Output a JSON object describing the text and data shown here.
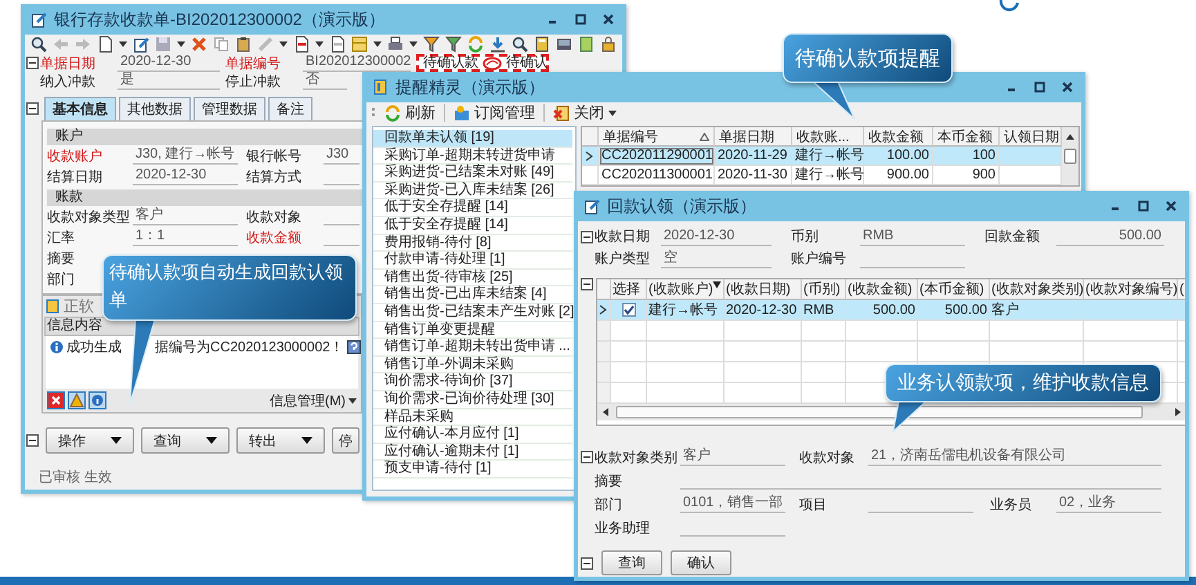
{
  "bank_receipt_window": {
    "title": "银行存款收款单-BI202012300002（演示版）",
    "flagged_tabs": [
      "待确认款",
      "待确认"
    ],
    "header_fields": [
      {
        "label": "单据日期",
        "value": "2020-12-30",
        "required": true
      },
      {
        "label": "单据编号",
        "value": "BI202012300002",
        "required": true
      },
      {
        "label": "纳入冲款",
        "value": "是",
        "required": false
      },
      {
        "label": "停止冲款",
        "value": "否",
        "required": false
      }
    ],
    "tabs": [
      {
        "label": "基本信息",
        "selected": true
      },
      {
        "label": "其他数据",
        "selected": false
      },
      {
        "label": "管理数据",
        "selected": false
      },
      {
        "label": "备注",
        "selected": false
      }
    ],
    "sections": [
      {
        "title": "账户",
        "rows": [
          [
            {
              "label": "收款账户",
              "value": "J30, 建行→帐号",
              "required": true
            },
            {
              "label": "银行帐号",
              "value": "J30",
              "required": false
            }
          ],
          [
            {
              "label": "结算日期",
              "value": "2020-12-30",
              "required": false
            },
            {
              "label": "结算方式",
              "required": false
            }
          ]
        ]
      },
      {
        "title": "账款",
        "rows": [
          [
            {
              "label": "收款对象类型",
              "value": "客户",
              "required": false
            },
            {
              "label": "收款对象",
              "required": false
            }
          ],
          [
            {
              "label": "汇率",
              "value": "1：1",
              "required": false
            },
            {
              "label": "收款金额",
              "required": true
            }
          ],
          [
            {
              "label": "摘要",
              "required": false
            }
          ],
          [
            {
              "label": "部门",
              "required": false
            }
          ]
        ]
      }
    ],
    "message_panel": {
      "title": "正软",
      "column": "信息内容",
      "message_parts": [
        "成功生成",
        "据编号为CC2020123000002！"
      ],
      "menu": "信息管理(M)"
    },
    "buttons": [
      {
        "label": "操作",
        "dropdown": true
      },
      {
        "label": "查询",
        "dropdown": true
      },
      {
        "label": "转出",
        "dropdown": true
      },
      {
        "label": "停",
        "dropdown": false
      }
    ],
    "status": "已审核 生效"
  },
  "reminder_window": {
    "title": "提醒精灵（演示版）",
    "toolbar": [
      {
        "label": "刷新",
        "kind": "refresh",
        "dropdown": false
      },
      {
        "label": "订阅管理",
        "kind": "subscribe",
        "dropdown": false
      },
      {
        "label": "关闭",
        "kind": "close",
        "dropdown": true
      }
    ],
    "items": [
      {
        "label": "回款单未认领 [19]",
        "selected": true
      },
      {
        "label": "采购订单-超期未转进货申请",
        "selected": false
      },
      {
        "label": "采购进货-已结案未对账 [49]",
        "selected": false
      },
      {
        "label": "采购进货-已入库未结案 [26]",
        "selected": false
      },
      {
        "label": "低于安全存提醒 [14]",
        "selected": false
      },
      {
        "label": "低于安全存提醒 [14]",
        "selected": false
      },
      {
        "label": "费用报销-待付 [8]",
        "selected": false
      },
      {
        "label": "付款申请-待处理 [1]",
        "selected": false
      },
      {
        "label": "销售出货-待审核 [25]",
        "selected": false
      },
      {
        "label": "销售出货-已出库未结案 [4]",
        "selected": false
      },
      {
        "label": "销售出货-已结案未产生对账 [2]",
        "selected": false
      },
      {
        "label": "销售订单变更提醒",
        "selected": false
      },
      {
        "label": "销售订单-超期未转出货申请 ...",
        "selected": false
      },
      {
        "label": "销售订单-外调未采购",
        "selected": false
      },
      {
        "label": "询价需求-待询价 [37]",
        "selected": false
      },
      {
        "label": "询价需求-已询价待处理 [30]",
        "selected": false
      },
      {
        "label": "样品未采购",
        "selected": false
      },
      {
        "label": "应付确认-本月应付 [1]",
        "selected": false
      },
      {
        "label": "应付确认-逾期未付 [1]",
        "selected": false
      },
      {
        "label": "预支申请-待付 [1]",
        "selected": false
      }
    ],
    "table": {
      "columns": [
        {
          "label": "单据编号",
          "kind": "text",
          "sorted": true
        },
        {
          "label": "单据日期",
          "kind": "text",
          "sorted": false
        },
        {
          "label": "收款账...",
          "kind": "text",
          "sorted": false
        },
        {
          "label": "收款金额",
          "kind": "amount",
          "sorted": false
        },
        {
          "label": "本币金额",
          "kind": "amount",
          "sorted": false
        },
        {
          "label": "认领日期",
          "kind": "text",
          "sorted": false
        }
      ],
      "rows": [
        {
          "selected": true,
          "cells": [
            "CC202011290001",
            "2020-11-29",
            "建行→帐号",
            "100.00",
            "100"
          ]
        },
        {
          "selected": false,
          "cells": [
            "CC202011300001",
            "2020-11-30",
            "建行→帐号",
            "900.00",
            "900"
          ]
        }
      ]
    }
  },
  "claim_window": {
    "title": "回款认领（演示版）",
    "header_fields": [
      {
        "label": "收款日期",
        "value": "2020-12-30",
        "kind": "text"
      },
      {
        "label": "币别",
        "value": "RMB",
        "kind": "text"
      },
      {
        "label": "回款金额",
        "value": "500.00",
        "kind": "amount"
      },
      {
        "label": "账户类型",
        "value": "空",
        "kind": "text"
      },
      {
        "label": "账户编号",
        "kind": "text"
      }
    ],
    "grid": {
      "columns": [
        {
          "label": "选择",
          "kind": "check",
          "sorted": false
        },
        {
          "label": "(收款账户)",
          "kind": "text",
          "sorted": true
        },
        {
          "label": "(收款日期)",
          "kind": "text",
          "sorted": false
        },
        {
          "label": "(币别)",
          "kind": "text",
          "sorted": false
        },
        {
          "label": "(收款金额)",
          "kind": "amount",
          "sorted": false
        },
        {
          "label": "(本币金额)",
          "kind": "amount",
          "sorted": false
        },
        {
          "label": "(收款对象类别)",
          "kind": "text",
          "sorted": false
        },
        {
          "label": "(收款对象编号)",
          "kind": "text",
          "sorted": false
        },
        {
          "label": "(",
          "kind": "text",
          "sorted": false
        }
      ],
      "rows": [
        {
          "selected": true,
          "checked": true,
          "cells": [
            "",
            "建行→帐号",
            "2020-12-30",
            "RMB",
            "500.00",
            "500.00",
            "客户"
          ]
        }
      ]
    },
    "detail_rows": [
      [
        {
          "label": "收款对象类别",
          "value": "客户",
          "kind": "short"
        },
        {
          "label": "收款对象",
          "value": "21，济南岳儒电机设备有限公司",
          "kind": "long"
        }
      ],
      [
        {
          "label": "摘要",
          "kind": "long"
        }
      ],
      [
        {
          "label": "部门",
          "value": "0101，销售一部",
          "kind": "short"
        },
        {
          "label": "项目",
          "kind": "short"
        },
        {
          "label": "业务员",
          "value": "02，业务",
          "kind": "short"
        }
      ],
      [
        {
          "label": "业务助理",
          "kind": "short"
        }
      ]
    ],
    "buttons": [
      "查询",
      "确认"
    ]
  },
  "callouts": [
    {
      "text": "待确认款项提醒"
    },
    {
      "text": "待确认款项自动生成回款认领单"
    },
    {
      "text": "业务认领款项，维护收款信息"
    }
  ]
}
